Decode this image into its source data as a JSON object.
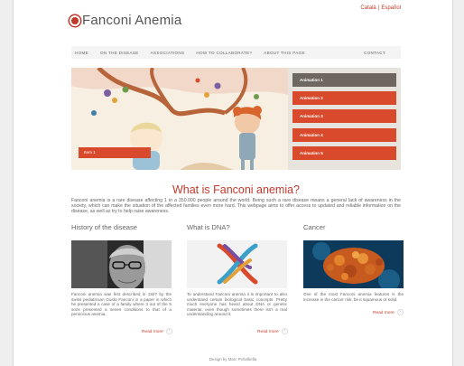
{
  "lang": {
    "a": "Català",
    "sep": "|",
    "b": "Español"
  },
  "logo": {
    "text": "Fanconi Anemia"
  },
  "nav": {
    "items": [
      "Home",
      "On the disease",
      "Associations",
      "How to collaborate?",
      "About this page"
    ],
    "contact": "Contact"
  },
  "slider": {
    "caption": "Item 1",
    "tabs": [
      "Animation 1",
      "Animation 2",
      "Animation 3",
      "Animation 4",
      "Animation 5"
    ]
  },
  "main": {
    "title": "What is Fanconi anemia?",
    "intro": "Fanconi anemia is a rare disease affecting 1 in a 350.000 people around the world. Being such a rare disease means a general lack of awareness in the society, which can make the situation of the affected families even more hard. This webpage aims to offer access to updated and reliable information on the disease, as well as try to help raise awareness."
  },
  "columns": [
    {
      "title": "History of the disease",
      "text": "Fanconi anemia was first described in 1927 by the swiss pediatrician Guido Fanconi in a paper in which he presented a case of a family where 3 out of the 5 sons presented a series conditions to that of a pernicious anemia.",
      "more": "Read more"
    },
    {
      "title": "What is DNA?",
      "text": "To understand Fanconi anemia it is important to also understand certain biological basic concepts. Pretty much everyone has heard about DNA or genetic material, even though sometimes there isn't a real understanding around it.",
      "more": "Read more"
    },
    {
      "title": "Cancer",
      "text": "One of the most Fanconi anemia features is the increase in the cancer risk, be it squamous or solid.",
      "more": "Read more"
    }
  ],
  "footer": {
    "text": "Design by Marc Peñalbella"
  },
  "colors": {
    "accent": "#c0392b",
    "tab": "#d9492c",
    "tab_active": "#6e6660"
  }
}
